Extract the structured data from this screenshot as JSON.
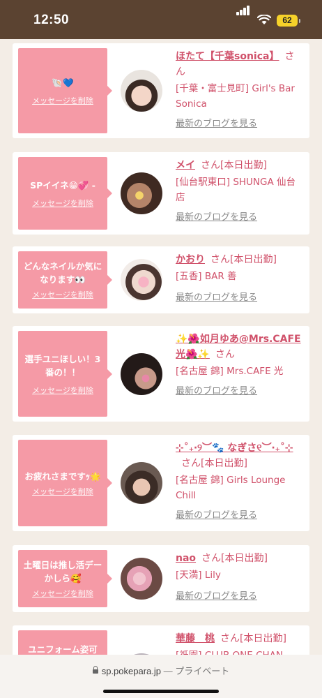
{
  "status_bar": {
    "time": "12:50",
    "battery": "62"
  },
  "cards": [
    {
      "message": "🐚💙",
      "delete_label": "メッセージを削除",
      "name": "ほたて【千葉sonica】",
      "suffix": "さん",
      "shop": "[千葉・富士見町] Girl's Bar Sonica",
      "blog_label": "最新のブログを見る"
    },
    {
      "message": "SPイイネ😁💞 -",
      "delete_label": "メッセージを削除",
      "name": "メイ",
      "suffix": "さん[本日出勤]",
      "shop": "[仙台駅東口] SHUNGA 仙台店",
      "blog_label": "最新のブログを見る"
    },
    {
      "message": "どんなネイルか気になります👀",
      "delete_label": "メッセージを削除",
      "name": "かおり",
      "suffix": "さん[本日出勤]",
      "shop": "[五香] BAR 善",
      "blog_label": "最新のブログを見る"
    },
    {
      "message": "選手ユニほしい！3番の！！",
      "delete_label": "メッセージを削除",
      "name": "✨🌺如月ゆあ@Mrs.CAFE光🌺✨",
      "suffix": "さん",
      "shop": "[名古屋 錦] Mrs.CAFE 光",
      "blog_label": "最新のブログを見る"
    },
    {
      "message": "お疲れさまですｯ🌟",
      "delete_label": "メッセージを削除",
      "name": "⊹˚₊‧୨︶🐾 なぎさ୧︶‧₊˚⊹",
      "suffix": "さん[本日出勤]",
      "shop": "[名古屋 錦] Girls Lounge Chill",
      "blog_label": "最新のブログを見る"
    },
    {
      "message": "土曜日は推し活デーかしら🥰",
      "delete_label": "メッセージを削除",
      "name": "nao",
      "suffix": "さん[本日出勤]",
      "shop": "[天満] Lily",
      "blog_label": "最新のブログを見る"
    },
    {
      "message": "ユニフォーム姿可",
      "delete_label": "",
      "name": "華藤　桃",
      "suffix": "さん[本日出勤]",
      "shop": "[祇園] CLUB ONE CHAN",
      "blog_label": ""
    }
  ],
  "browser": {
    "domain": "sp.pokepara.jp",
    "separator": "—",
    "mode": "プライベート"
  }
}
